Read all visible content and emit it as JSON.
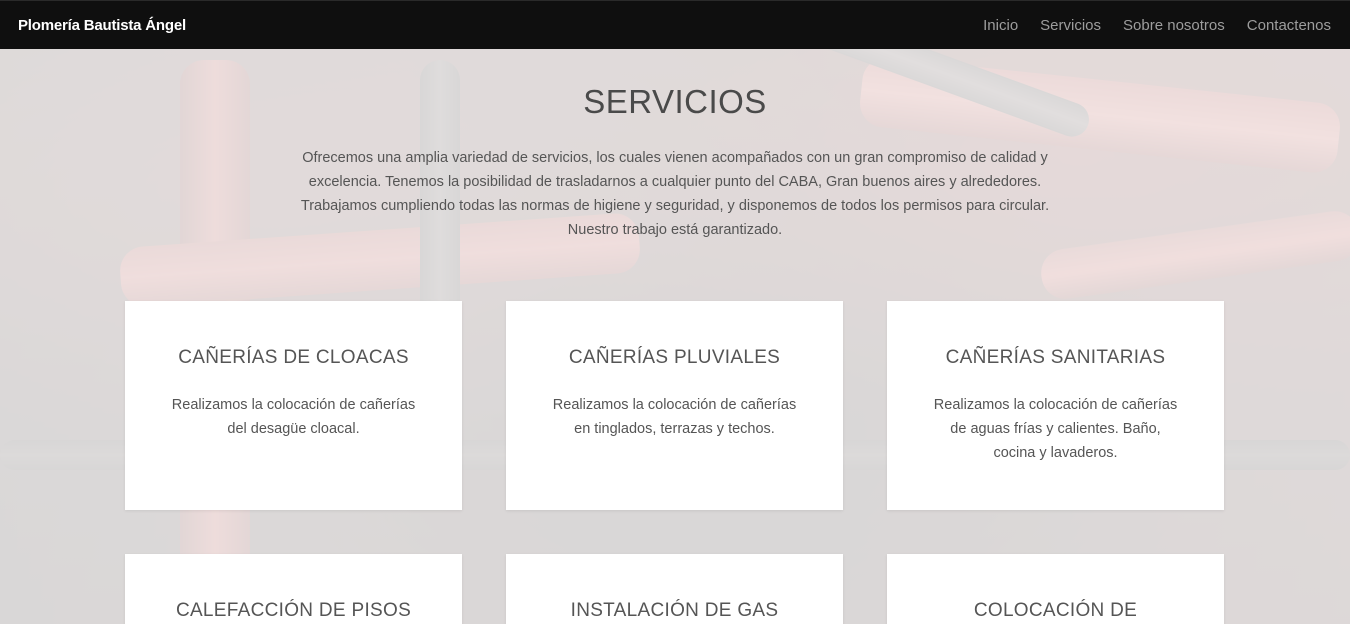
{
  "navbar": {
    "brand": "Plomería Bautista Ángel",
    "links": [
      "Inicio",
      "Servicios",
      "Sobre nosotros",
      "Contactenos"
    ]
  },
  "services": {
    "heading": "SERVICIOS",
    "intro": "Ofrecemos una amplia variedad de servicios, los cuales vienen acompañados con un gran compromiso de calidad y excelencia. Tenemos la posibilidad de trasladarnos a cualquier punto del CABA, Gran buenos aires y alrededores. Trabajamos cumpliendo todas las normas de higiene y seguridad, y disponemos de todos los permisos para circular. Nuestro trabajo está garantizado.",
    "cards": [
      {
        "title": "CAÑERÍAS DE CLOACAS",
        "text": "Realizamos la colocación de cañerías del desagüe cloacal."
      },
      {
        "title": "CAÑERÍAS PLUVIALES",
        "text": "Realizamos la colocación de cañerías en tinglados, terrazas y techos."
      },
      {
        "title": "CAÑERÍAS SANITARIAS",
        "text": "Realizamos la colocación de cañerías de aguas frías y calientes. Baño, cocina y lavaderos."
      },
      {
        "title": "CALEFACCIÓN DE PISOS",
        "text": ""
      },
      {
        "title": "INSTALACIÓN DE GAS",
        "text": ""
      },
      {
        "title": "COLOCACIÓN DE",
        "text": ""
      }
    ]
  }
}
